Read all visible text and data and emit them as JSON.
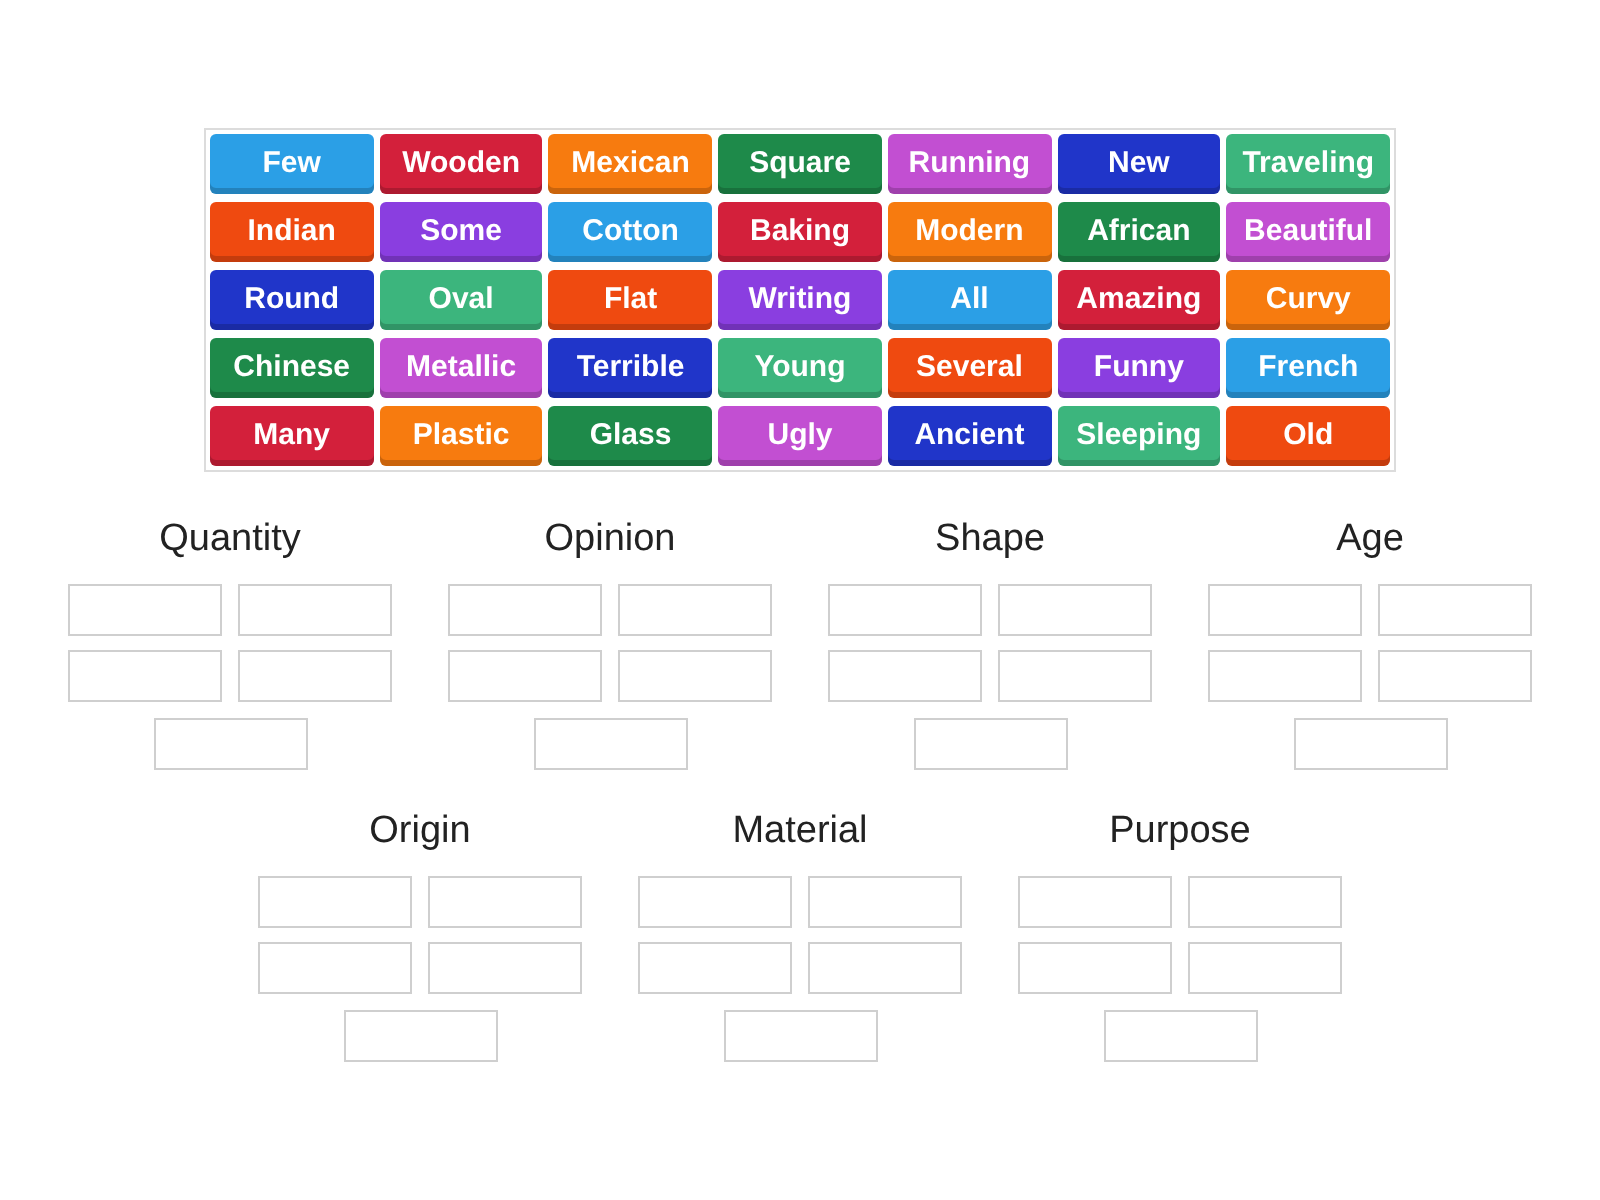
{
  "tiles": [
    {
      "label": "Few",
      "color": "#2b9fe6"
    },
    {
      "label": "Wooden",
      "color": "#d3203b"
    },
    {
      "label": "Mexican",
      "color": "#f77b0f"
    },
    {
      "label": "Square",
      "color": "#1e8a4a"
    },
    {
      "label": "Running",
      "color": "#c24fd2"
    },
    {
      "label": "New",
      "color": "#2035c9"
    },
    {
      "label": "Traveling",
      "color": "#3cb57d"
    },
    {
      "label": "Indian",
      "color": "#ef4a10"
    },
    {
      "label": "Some",
      "color": "#8a3ee0"
    },
    {
      "label": "Cotton",
      "color": "#2b9fe6"
    },
    {
      "label": "Baking",
      "color": "#d3203b"
    },
    {
      "label": "Modern",
      "color": "#f77b0f"
    },
    {
      "label": "African",
      "color": "#1e8a4a"
    },
    {
      "label": "Beautiful",
      "color": "#c24fd2"
    },
    {
      "label": "Round",
      "color": "#2035c9"
    },
    {
      "label": "Oval",
      "color": "#3cb57d"
    },
    {
      "label": "Flat",
      "color": "#ef4a10"
    },
    {
      "label": "Writing",
      "color": "#8a3ee0"
    },
    {
      "label": "All",
      "color": "#2b9fe6"
    },
    {
      "label": "Amazing",
      "color": "#d3203b"
    },
    {
      "label": "Curvy",
      "color": "#f77b0f"
    },
    {
      "label": "Chinese",
      "color": "#1e8a4a"
    },
    {
      "label": "Metallic",
      "color": "#c24fd2"
    },
    {
      "label": "Terrible",
      "color": "#2035c9"
    },
    {
      "label": "Young",
      "color": "#3cb57d"
    },
    {
      "label": "Several",
      "color": "#ef4a10"
    },
    {
      "label": "Funny",
      "color": "#8a3ee0"
    },
    {
      "label": "French",
      "color": "#2b9fe6"
    },
    {
      "label": "Many",
      "color": "#d3203b"
    },
    {
      "label": "Plastic",
      "color": "#f77b0f"
    },
    {
      "label": "Glass",
      "color": "#1e8a4a"
    },
    {
      "label": "Ugly",
      "color": "#c24fd2"
    },
    {
      "label": "Ancient",
      "color": "#2035c9"
    },
    {
      "label": "Sleeping",
      "color": "#3cb57d"
    },
    {
      "label": "Old",
      "color": "#ef4a10"
    }
  ],
  "groups": [
    {
      "title": "Quantity"
    },
    {
      "title": "Opinion"
    },
    {
      "title": "Shape"
    },
    {
      "title": "Age"
    },
    {
      "title": "Origin"
    },
    {
      "title": "Material"
    },
    {
      "title": "Purpose"
    }
  ]
}
